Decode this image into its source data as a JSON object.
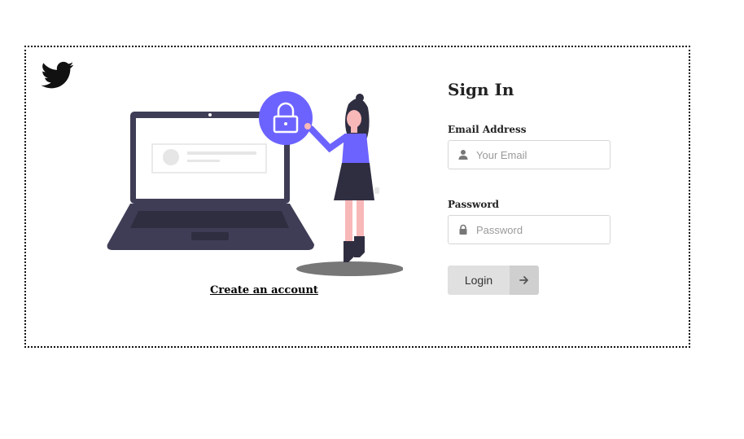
{
  "brand": {
    "logo_icon": "twitter-bird-icon"
  },
  "illustration": {
    "icon": "laptop-woman-lock-illustration",
    "accent_color": "#6c63ff"
  },
  "create_account": {
    "label": "Create an account"
  },
  "signin": {
    "title": "Sign In",
    "email": {
      "label": "Email Address",
      "placeholder": "Your Email",
      "value": "",
      "icon": "user-icon"
    },
    "password": {
      "label": "Password",
      "placeholder": "Password",
      "value": "",
      "icon": "lock-icon"
    },
    "login": {
      "label": "Login",
      "icon": "arrow-right-icon"
    }
  }
}
